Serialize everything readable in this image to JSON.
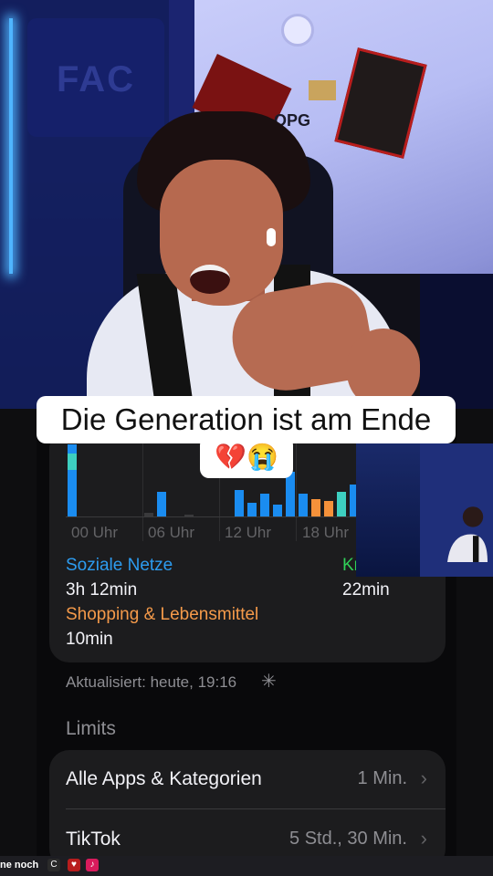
{
  "caption": {
    "line1": "Die Generation ist am Ende",
    "line2": "💔😭"
  },
  "screen_time": {
    "chart_ticks": [
      "00 Uhr",
      "06 Uhr",
      "12 Uhr",
      "18 Uhr"
    ],
    "categories": [
      {
        "name": "Soziale Netze",
        "time": "3h 12min",
        "color": "#2d9cf0"
      },
      {
        "name": "Kr",
        "time": "22min",
        "color": "#30d158"
      },
      {
        "name": "Shopping & Lebensmittel",
        "time": "10min",
        "color": "#f59a4a"
      }
    ],
    "updated": "Aktualisiert: heute, 19:16",
    "spinner_icon": "loading-spinner-icon"
  },
  "limits": {
    "heading": "Limits",
    "rows": [
      {
        "label": "Alle Apps & Kategorien",
        "value": "1 Min.",
        "chevron": "›"
      },
      {
        "label": "TikTok",
        "value": "5 Std., 30 Min.",
        "chevron": "›"
      }
    ]
  },
  "background": {
    "sign_text": "FAC",
    "poster_text": "OPG"
  },
  "taskbar": {
    "text": "ne noch"
  }
}
